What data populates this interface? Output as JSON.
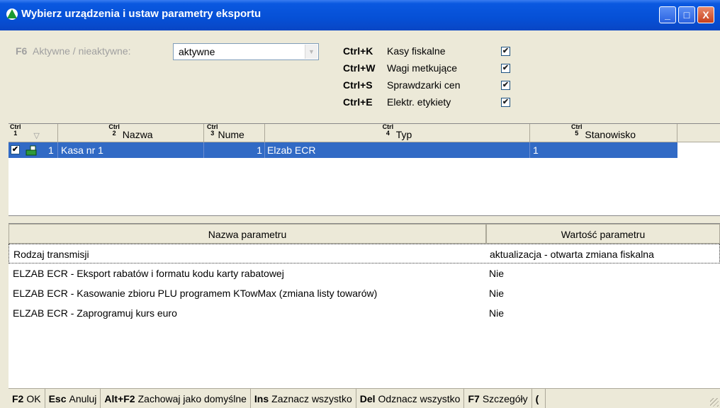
{
  "window": {
    "title": "Wybierz urządzenia i ustaw parametry eksportu",
    "min_label": "_",
    "max_label": "□",
    "close_label": "X"
  },
  "filter": {
    "key": "F6",
    "label": "Aktywne / nieaktywne:",
    "value": "aktywne"
  },
  "device_types": [
    {
      "shortcut": "Ctrl+K",
      "label": "Kasy fiskalne",
      "checked": true
    },
    {
      "shortcut": "Ctrl+W",
      "label": "Wagi metkujące",
      "checked": true
    },
    {
      "shortcut": "Ctrl+S",
      "label": "Sprawdzarki cen",
      "checked": true
    },
    {
      "shortcut": "Ctrl+E",
      "label": "Elektr. etykiety",
      "checked": true
    }
  ],
  "devices_table": {
    "columns": [
      {
        "ctrl": "Ctrl",
        "num": "1",
        "label": ""
      },
      {
        "ctrl": "Ctrl",
        "num": "2",
        "label": "Nazwa"
      },
      {
        "ctrl": "Ctrl",
        "num": "3",
        "label": "Nume"
      },
      {
        "ctrl": "Ctrl",
        "num": "4",
        "label": "Typ"
      },
      {
        "ctrl": "Ctrl",
        "num": "5",
        "label": "Stanowisko"
      }
    ],
    "rows": [
      {
        "checked": true,
        "lp": "1",
        "nazwa": "Kasa nr 1",
        "numer": "1",
        "typ": "Elzab ECR",
        "stanowisko": "1",
        "selected": true
      }
    ]
  },
  "params_table": {
    "columns": [
      "Nazwa parametru",
      "Wartość parametru"
    ],
    "rows": [
      {
        "name": "Rodzaj transmisji",
        "value": "aktualizacja - otwarta zmiana fiskalna"
      },
      {
        "name": "ELZAB ECR - Eksport rabatów i formatu kodu karty rabatowej",
        "value": "Nie"
      },
      {
        "name": "ELZAB ECR - Kasowanie zbioru PLU programem KTowMax (zmiana listy towarów)",
        "value": "Nie"
      },
      {
        "name": "ELZAB ECR - Zaprogramuj kurs euro",
        "value": "Nie"
      }
    ]
  },
  "statusbar": [
    {
      "key": "F2",
      "label": "OK"
    },
    {
      "key": "Esc",
      "label": "Anuluj"
    },
    {
      "key": "Alt+F2",
      "label": "Zachowaj jako domyślne"
    },
    {
      "key": "Ins",
      "label": "Zaznacz wszystko"
    },
    {
      "key": "Del",
      "label": "Odznacz wszystko"
    },
    {
      "key": "F7",
      "label": "Szczegóły"
    },
    {
      "key": "(",
      "label": ""
    }
  ],
  "colors": {
    "titlebar": "#0650d6",
    "selection": "#316ac5",
    "window_bg": "#ece9d8",
    "check_green": "#21a121"
  },
  "icons": {
    "app": "green-triangle-icon",
    "device": "cash-register-icon",
    "sort": "sort-triangle-icon",
    "resize": "resize-grip-icon"
  }
}
